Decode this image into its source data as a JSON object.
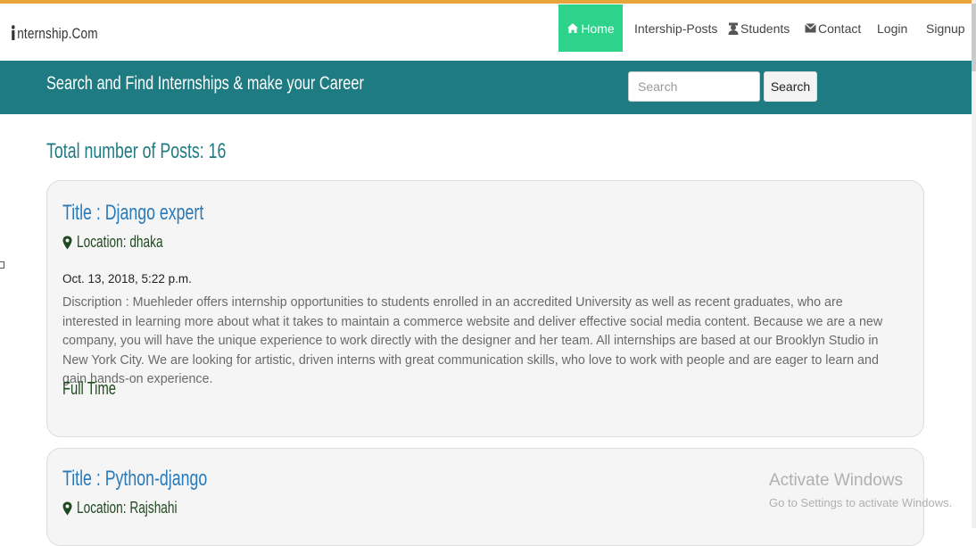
{
  "brand": {
    "name": "nternship.Com",
    "icon": "person-icon"
  },
  "nav": {
    "home": {
      "label": "Home",
      "icon": "home-icon"
    },
    "posts": {
      "label": "Intership-Posts"
    },
    "students": {
      "label": "Students",
      "icon": "student-icon"
    },
    "contact": {
      "label": "Contact",
      "icon": "envelope-icon"
    },
    "login": {
      "label": "Login"
    },
    "signup": {
      "label": "Signup"
    }
  },
  "banner": {
    "tagline": "Search and Find Internships & make your Career",
    "search_placeholder": "Search",
    "search_value": "",
    "search_button": "Search"
  },
  "main": {
    "total_posts": "Total number of Posts: 16",
    "posts": [
      {
        "title": "Title : Django expert",
        "location": "Location: dhaka",
        "date": "Oct. 13, 2018, 5:22 p.m.",
        "description": "Discription : Muehleder offers internship opportunities to students enrolled in an accredited University as well as recent graduates, who are interested in learning more about what it takes to maintain a commerce website and deliver effective social media content. Because we are a new company, you will have the unique experience to work directly with the designer and her team. All internships are based at our Brooklyn Studio in New York City. We are looking for artistic, driven interns with great communication skills, who love to work with people and are eager to learn and gain hands-on experience.",
        "type": "Full Time"
      },
      {
        "title": "Title : Python-django",
        "location": "Location: Rajshahi"
      }
    ]
  },
  "watermark": {
    "title": "Activate Windows",
    "subtitle": "Go to Settings to activate Windows."
  },
  "colors": {
    "top_stripe": "#e8a33a",
    "nav_active": "#2dd38a",
    "banner": "#1e7b81",
    "title_blue": "#2a7ab8",
    "location_green": "#1f4a1f"
  }
}
